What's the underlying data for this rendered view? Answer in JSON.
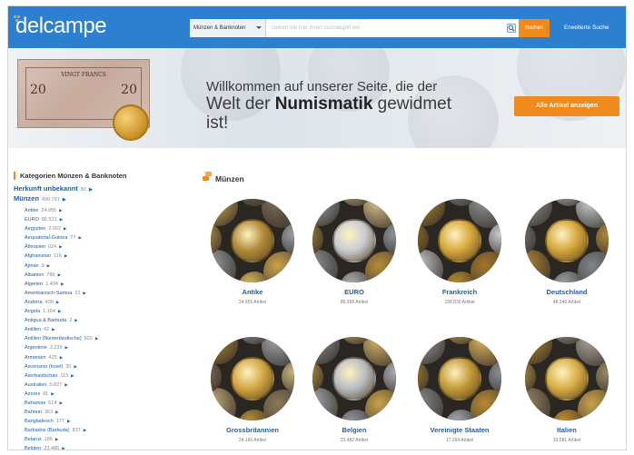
{
  "header": {
    "logo": "delcampe",
    "search_category": "Münzen & Banknoten",
    "search_placeholder": "Geben Sie hier Ihren Suchbegriff ein",
    "search_button": "Suchen",
    "advanced_search": "Erweiterte Suche"
  },
  "hero": {
    "line1": "Willkommen auf unserer Seite, die der",
    "line2_pre": "Welt der ",
    "line2_bold": "Numismatik",
    "line2_post": " gewidmet",
    "line3": "ist!",
    "cta": "Alle Artikel anzeigen",
    "banknote_title": "VINGT FRANCS",
    "banknote_value": "20"
  },
  "sidebar": {
    "title": "Kategorien Münzen & Banknoten",
    "top": [
      {
        "label": "Herkunft unbekannt",
        "count": "82"
      },
      {
        "label": "Münzen",
        "count": "490.791"
      }
    ],
    "items": [
      {
        "label": "Antike",
        "count": "24.955"
      },
      {
        "label": "EURO",
        "count": "86.521"
      },
      {
        "label": "Aegypten",
        "count": "2.652"
      },
      {
        "label": "Aequatorial-Guinea",
        "count": "77"
      },
      {
        "label": "Äthiopien",
        "count": "624"
      },
      {
        "label": "Afghanistan",
        "count": "116"
      },
      {
        "label": "Ajman",
        "count": "9"
      },
      {
        "label": "Albanien",
        "count": "786"
      },
      {
        "label": "Algerien",
        "count": "1.494"
      },
      {
        "label": "Amerikanisch-Samoa",
        "count": "22"
      },
      {
        "label": "Andorra",
        "count": "409"
      },
      {
        "label": "Angola",
        "count": "1.164"
      },
      {
        "label": "Antigua & Barbuda",
        "count": "2"
      },
      {
        "label": "Antillen",
        "count": "42"
      },
      {
        "label": "Antillen (Niederländische)",
        "count": "822"
      },
      {
        "label": "Argentinie",
        "count": "3.239"
      },
      {
        "label": "Armenien",
        "count": "425"
      },
      {
        "label": "Ascension (Insel)",
        "count": "30"
      },
      {
        "label": "Aserbaidschan",
        "count": "119"
      },
      {
        "label": "Australien",
        "count": "5.827"
      },
      {
        "label": "Azores",
        "count": "81"
      },
      {
        "label": "Bahamas",
        "count": "614"
      },
      {
        "label": "Bahrein",
        "count": "362"
      },
      {
        "label": "Bangladesch",
        "count": "177"
      },
      {
        "label": "Barbados (Barbuda)",
        "count": "837"
      },
      {
        "label": "Belarus",
        "count": "185"
      },
      {
        "label": "Belgien",
        "count": "23.486"
      }
    ]
  },
  "main": {
    "section_title": "Münzen",
    "categories": [
      {
        "label": "Antike",
        "count": "24.955 Artikel"
      },
      {
        "label": "EURO",
        "count": "86.368 Artikel"
      },
      {
        "label": "Frankreich",
        "count": "158.830 Artikel"
      },
      {
        "label": "Deutschland",
        "count": "48.346 Artikel"
      },
      {
        "label": "Grossbritannien",
        "count": "24.166 Artikel"
      },
      {
        "label": "Belgien",
        "count": "23.482 Artikel"
      },
      {
        "label": "Vereinigte Staaten",
        "count": "17.264 Artikel"
      },
      {
        "label": "Italien",
        "count": "33.581 Artikel"
      }
    ]
  },
  "colors": {
    "header_bg": "#2d7fd0",
    "accent_orange": "#f08a1f",
    "link_blue": "#1f5fa6"
  },
  "icons": [
    "search-icon",
    "chevron-down-icon",
    "caret-right-icon",
    "coins-icon"
  ]
}
